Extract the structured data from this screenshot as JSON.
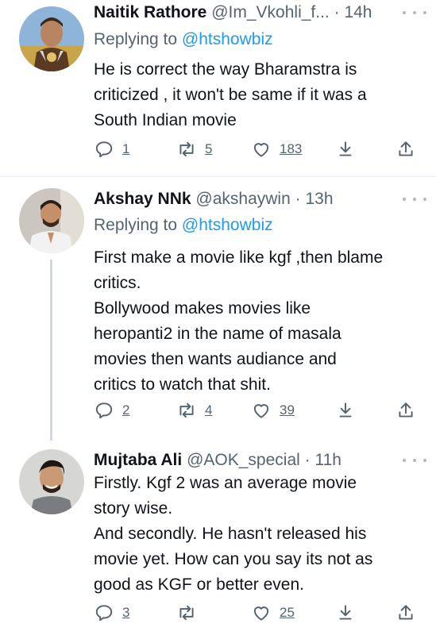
{
  "tweets": [
    {
      "name": "Naitik Rathore",
      "handle": "@Im_Vkohli_f...",
      "separator": "·",
      "time": "14h",
      "replying_prefix": "Replying to",
      "replying_to": "@htshowbiz",
      "lines": [
        "He is correct the way  Bharamstra is",
        "criticized , it won't be same if it was a",
        "South Indian movie"
      ],
      "replies": "1",
      "retweets": "5",
      "likes": "183"
    },
    {
      "name": "Akshay NNk",
      "handle": "@akshaywin",
      "separator": "·",
      "time": "13h",
      "replying_prefix": "Replying to",
      "replying_to": "@htshowbiz",
      "lines": [
        "First make a movie like kgf ,then blame",
        "critics.",
        "Bollywood makes movies like",
        "heropanti2 in the name of masala",
        "movies then wants audiance and",
        "critics to watch that shit."
      ],
      "replies": "2",
      "retweets": "4",
      "likes": "39"
    },
    {
      "name": "Mujtaba Ali",
      "handle": "@AOK_special",
      "separator": "·",
      "time": "11h",
      "lines": [
        "Firstly. Kgf 2 was an average movie",
        "story wise.",
        "And secondly. He hasn't released his",
        "movie yet. How can you say its not as",
        "good as KGF or better even."
      ],
      "replies": "3",
      "retweets": "",
      "likes": "25"
    }
  ],
  "icons": {
    "reply": "reply-icon",
    "retweet": "retweet-icon",
    "like": "heart-icon",
    "save": "save-icon",
    "share": "share-icon",
    "more": "more-icon"
  },
  "colors": {
    "text": "#0f1419",
    "secondary": "#536471",
    "link": "#1d9bf0",
    "thread_line": "#cfd9de"
  }
}
